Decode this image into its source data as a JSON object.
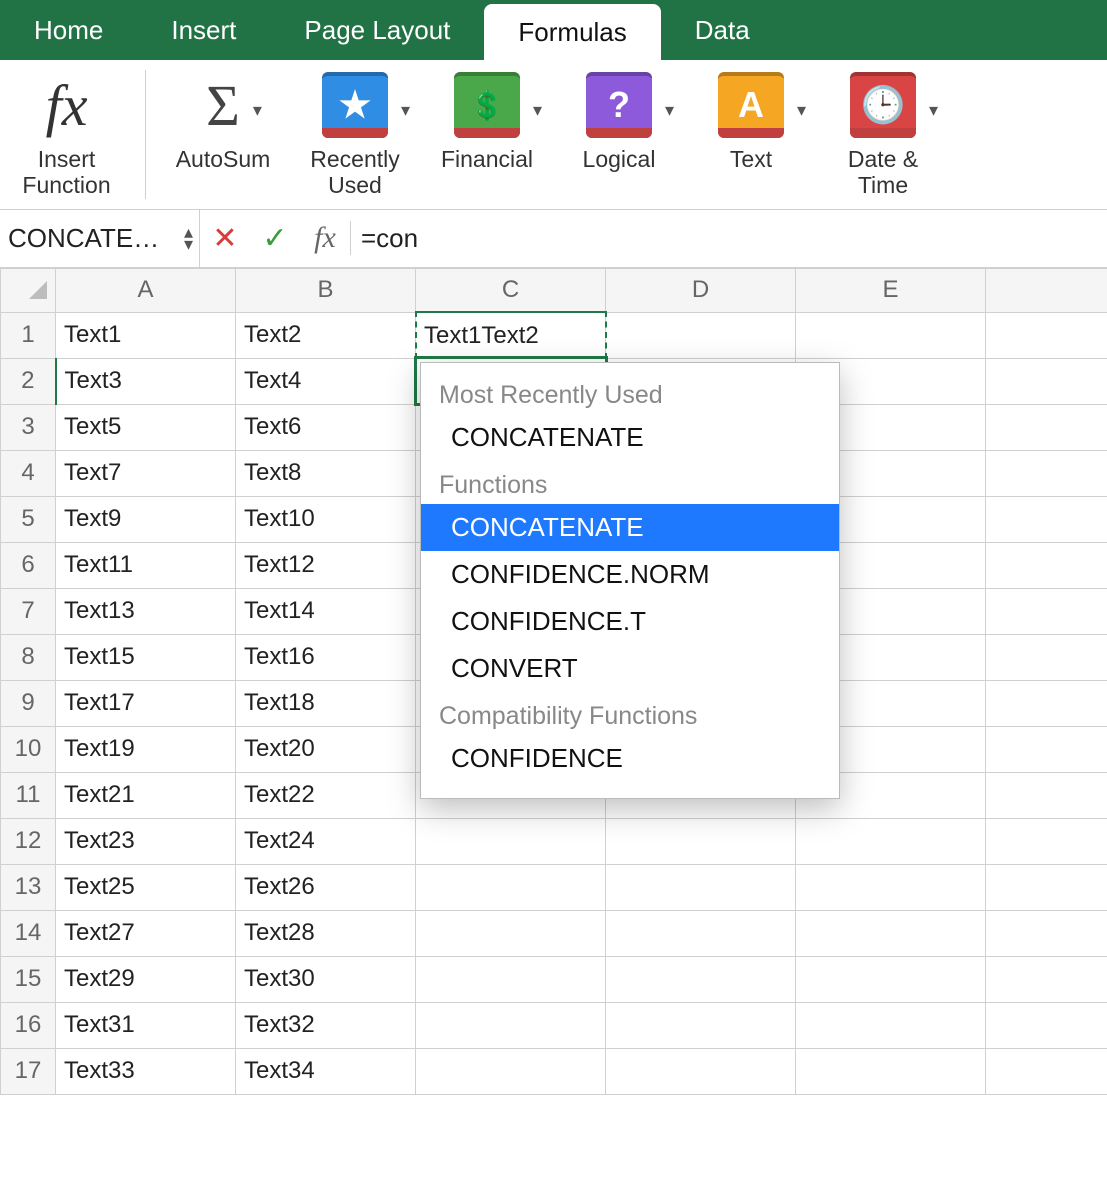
{
  "tabs": {
    "items": [
      {
        "label": "Home",
        "active": false
      },
      {
        "label": "Insert",
        "active": false
      },
      {
        "label": "Page Layout",
        "active": false
      },
      {
        "label": "Formulas",
        "active": true
      },
      {
        "label": "Data",
        "active": false
      }
    ]
  },
  "ribbon": {
    "insert_function": "Insert\nFunction",
    "autosum": "AutoSum",
    "recently_used": "Recently\nUsed",
    "financial": "Financial",
    "logical": "Logical",
    "text": "Text",
    "date_time": "Date &\nTime"
  },
  "formula_bar": {
    "name_box": "CONCATE…",
    "formula": "=con"
  },
  "columns": [
    "A",
    "B",
    "C",
    "D",
    "E"
  ],
  "rows": [
    {
      "n": 1,
      "A": "Text1",
      "B": "Text2",
      "C": "Text1Text2"
    },
    {
      "n": 2,
      "A": "Text3",
      "B": "Text4",
      "C": "=con",
      "editing": true
    },
    {
      "n": 3,
      "A": "Text5",
      "B": "Text6"
    },
    {
      "n": 4,
      "A": "Text7",
      "B": "Text8"
    },
    {
      "n": 5,
      "A": "Text9",
      "B": "Text10"
    },
    {
      "n": 6,
      "A": "Text11",
      "B": "Text12"
    },
    {
      "n": 7,
      "A": "Text13",
      "B": "Text14"
    },
    {
      "n": 8,
      "A": "Text15",
      "B": "Text16"
    },
    {
      "n": 9,
      "A": "Text17",
      "B": "Text18"
    },
    {
      "n": 10,
      "A": "Text19",
      "B": "Text20"
    },
    {
      "n": 11,
      "A": "Text21",
      "B": "Text22"
    },
    {
      "n": 12,
      "A": "Text23",
      "B": "Text24"
    },
    {
      "n": 13,
      "A": "Text25",
      "B": "Text26"
    },
    {
      "n": 14,
      "A": "Text27",
      "B": "Text28"
    },
    {
      "n": 15,
      "A": "Text29",
      "B": "Text30"
    },
    {
      "n": 16,
      "A": "Text31",
      "B": "Text32"
    },
    {
      "n": 17,
      "A": "Text33",
      "B": "Text34"
    }
  ],
  "autocomplete": {
    "sections": [
      {
        "header": "Most Recently Used",
        "items": [
          {
            "label": "CONCATENATE",
            "selected": false
          }
        ]
      },
      {
        "header": "Functions",
        "items": [
          {
            "label": "CONCATENATE",
            "selected": true
          },
          {
            "label": "CONFIDENCE.NORM",
            "selected": false
          },
          {
            "label": "CONFIDENCE.T",
            "selected": false
          },
          {
            "label": "CONVERT",
            "selected": false
          }
        ]
      },
      {
        "header": "Compatibility Functions",
        "items": [
          {
            "label": "CONFIDENCE",
            "selected": false
          }
        ]
      }
    ]
  }
}
